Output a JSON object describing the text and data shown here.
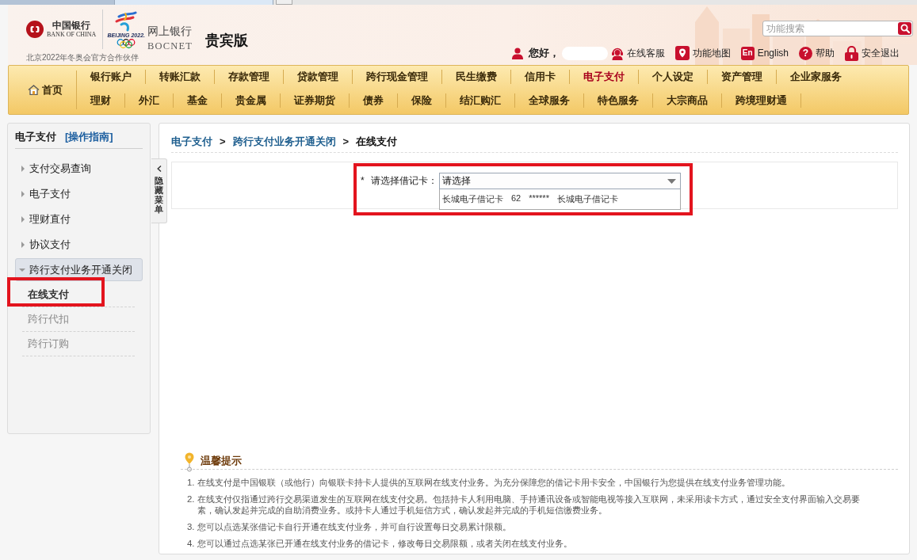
{
  "browser_tabs": [
    {
      "selected": false
    },
    {
      "selected": true
    }
  ],
  "header": {
    "bank_logo": {
      "name_cn": "中国银行",
      "name_en": "BANK OF CHINA"
    },
    "emblem": {
      "text": "BEIJING 2022."
    },
    "partner_line": "北京2022年冬奥会官方合作伙伴",
    "product": {
      "title": "网上银行",
      "subtitle": "BOCNET",
      "edition": "贵宾版"
    },
    "search": {
      "placeholder": "功能搜索"
    },
    "greeting": "您好，",
    "links": [
      {
        "kind": "service",
        "label": "在线客服"
      },
      {
        "kind": "map",
        "label": "功能地图"
      },
      {
        "kind": "english",
        "icon_text": "En",
        "label": "English"
      },
      {
        "kind": "help",
        "icon_text": "?",
        "label": "帮助"
      },
      {
        "kind": "logout",
        "label": "安全退出"
      }
    ]
  },
  "nav": {
    "home": {
      "label": "首页"
    },
    "rows": [
      {
        "items": [
          {
            "label": "银行账户",
            "selected": false
          },
          {
            "label": "转账汇款",
            "selected": false
          },
          {
            "label": "存款管理",
            "selected": false
          },
          {
            "label": "贷款管理",
            "selected": false
          },
          {
            "label": "跨行现金管理",
            "selected": false
          },
          {
            "label": "民生缴费",
            "selected": false
          },
          {
            "label": "信用卡",
            "selected": false
          },
          {
            "label": "电子支付",
            "selected": true
          },
          {
            "label": "个人设定",
            "selected": false
          },
          {
            "label": "资产管理",
            "selected": false
          },
          {
            "label": "企业家服务",
            "selected": false
          }
        ]
      },
      {
        "items": [
          {
            "label": "理财",
            "selected": false
          },
          {
            "label": "外汇",
            "selected": false
          },
          {
            "label": "基金",
            "selected": false
          },
          {
            "label": "贵金属",
            "selected": false
          },
          {
            "label": "证券期货",
            "selected": false
          },
          {
            "label": "债券",
            "selected": false
          },
          {
            "label": "保险",
            "selected": false
          },
          {
            "label": "结汇购汇",
            "selected": false
          },
          {
            "label": "全球服务",
            "selected": false
          },
          {
            "label": "特色服务",
            "selected": false
          },
          {
            "label": "大宗商品",
            "selected": false
          },
          {
            "label": "跨境理财通",
            "selected": false
          }
        ]
      }
    ]
  },
  "sidebar": {
    "title": "电子支付",
    "guide_link": "[操作指南]",
    "items": [
      {
        "label": "支付交易查询",
        "expanded": false
      },
      {
        "label": "电子支付",
        "expanded": false
      },
      {
        "label": "理财直付",
        "expanded": false
      },
      {
        "label": "协议支付",
        "expanded": false
      },
      {
        "label": "跨行支付业务开通关闭",
        "expanded": true,
        "children": [
          {
            "label": "在线支付",
            "selected": true,
            "highlighted": true
          },
          {
            "label": "跨行代扣",
            "selected": false,
            "highlighted": false
          },
          {
            "label": "跨行订购",
            "selected": false,
            "highlighted": false
          }
        ]
      }
    ]
  },
  "hide_menu": {
    "label": "隐藏菜单"
  },
  "main": {
    "breadcrumb": [
      {
        "kind": "link",
        "label": "电子支付"
      },
      {
        "kind": "separator",
        "label": ">"
      },
      {
        "kind": "link",
        "label": "跨行支付业务开通关闭"
      },
      {
        "kind": "separator",
        "label": ">"
      },
      {
        "kind": "current",
        "label": "在线支付"
      }
    ],
    "form": {
      "required_mark": "*",
      "label": "请选择借记卡：",
      "value": "请选择",
      "expanded": true,
      "highlighted": true,
      "options": [
        {
          "parts": [
            "长城电子借记卡",
            "62",
            "******",
            "长城电子借记卡"
          ]
        }
      ]
    },
    "tips": {
      "title": "温馨提示",
      "items": [
        {
          "number": "1.",
          "text": "在线支付是中国银联（或他行）向银联卡持卡人提供的互联网在线支付业务。为充分保障您的借记卡用卡安全，中国银行为您提供在线支付业务管理功能。"
        },
        {
          "number": "2.",
          "text": "在线支付仅指通过跨行交易渠道发生的互联网在线支付交易。包括持卡人利用电脑、手持通讯设备或智能电视等接入互联网，未采用读卡方式，通过安全支付界面输入交易要素，确认发起并完成的自助消费业务。或持卡人通过手机短信方式，确认发起并完成的手机短信缴费业务。"
        },
        {
          "number": "3.",
          "text": "您可以点选某张借记卡自行开通在线支付业务，并可自行设置每日交易累计限额。"
        },
        {
          "number": "4.",
          "text": "您可以通过点选某张已开通在线支付业务的借记卡，修改每日交易限额，或者关闭在线支付业务。"
        }
      ]
    }
  }
}
